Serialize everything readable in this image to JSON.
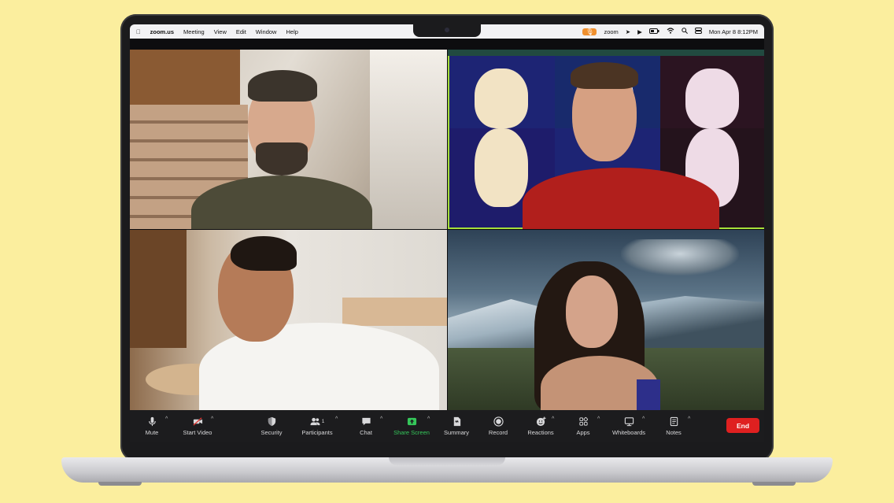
{
  "menubar": {
    "apple_icon": "apple-icon",
    "app": "zoom.us",
    "items": [
      "Meeting",
      "View",
      "Edit",
      "Window",
      "Help"
    ],
    "status": {
      "zoom_label": "zoom",
      "date_time": "Mon Apr 8  8:12PM"
    }
  },
  "toolbar": {
    "mute": "Mute",
    "start_video": "Start Video",
    "security": "Security",
    "participants": "Participants",
    "participants_count": "1",
    "chat": "Chat",
    "share_screen": "Share Screen",
    "summary": "Summary",
    "record": "Record",
    "reactions": "Reactions",
    "apps": "Apps",
    "whiteboards": "Whiteboards",
    "notes": "Notes",
    "end": "End"
  },
  "colors": {
    "background": "#fbee9e",
    "active_speaker_border": "#a6e03a",
    "share_green": "#35c75a",
    "end_red": "#df2020"
  }
}
